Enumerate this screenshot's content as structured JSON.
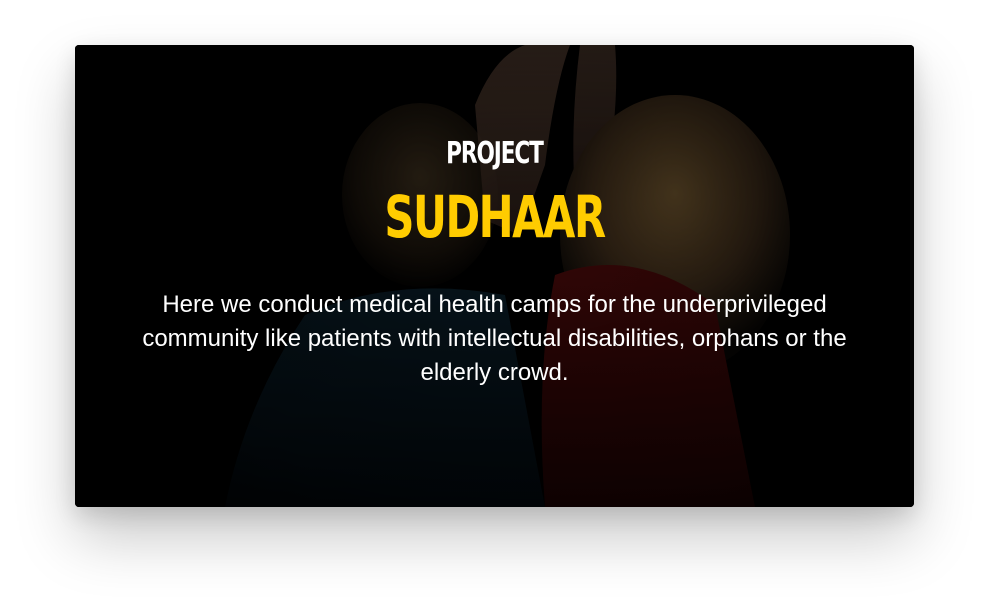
{
  "card": {
    "eyebrow": "PROJECT",
    "title": "SUDHAAR",
    "description": "Here we conduct medical health camps for the underprivileged community like patients with intellectual disabilities, orphans or the elderly crowd."
  },
  "colors": {
    "title_accent": "#ffcc00",
    "text": "#ffffff",
    "card_background": "#000000"
  }
}
